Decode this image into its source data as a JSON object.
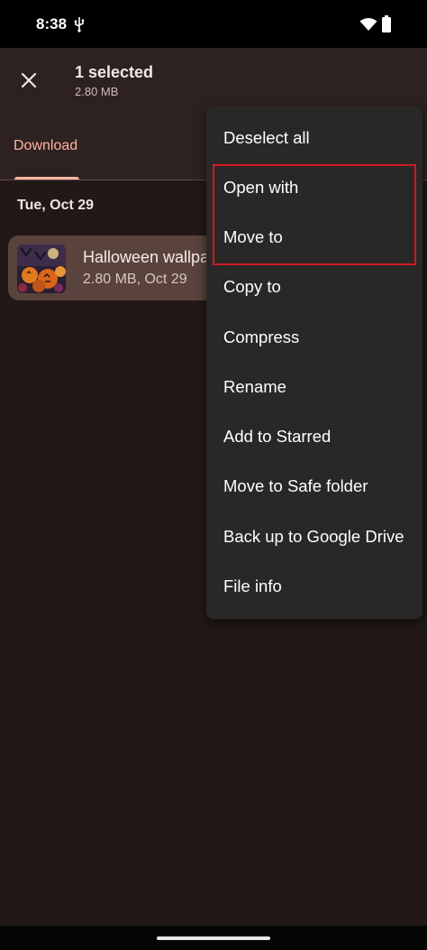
{
  "status_bar": {
    "time": "8:38",
    "icons": [
      "usb-icon",
      "wifi-icon",
      "battery-icon"
    ]
  },
  "header": {
    "selection_title": "1 selected",
    "selection_size": "2.80 MB",
    "close_icon": "close-icon"
  },
  "tabs": [
    {
      "label": "Download",
      "active": true
    }
  ],
  "section": {
    "date": "Tue, Oct 29"
  },
  "file": {
    "name": "Halloween wallpaper",
    "meta": "2.80 MB, Oct 29",
    "selected": true
  },
  "menu": {
    "items": [
      "Deselect all",
      "Open with",
      "Move to",
      "Copy to",
      "Compress",
      "Rename",
      "Add to Starred",
      "Move to Safe folder",
      "Back up to Google Drive",
      "File info"
    ],
    "highlighted": [
      "Move to",
      "Copy to"
    ]
  },
  "colors": {
    "accent": "#ffb4a3",
    "background": "#221917",
    "menu_background": "#2a2827",
    "highlight_border": "#d01822"
  }
}
